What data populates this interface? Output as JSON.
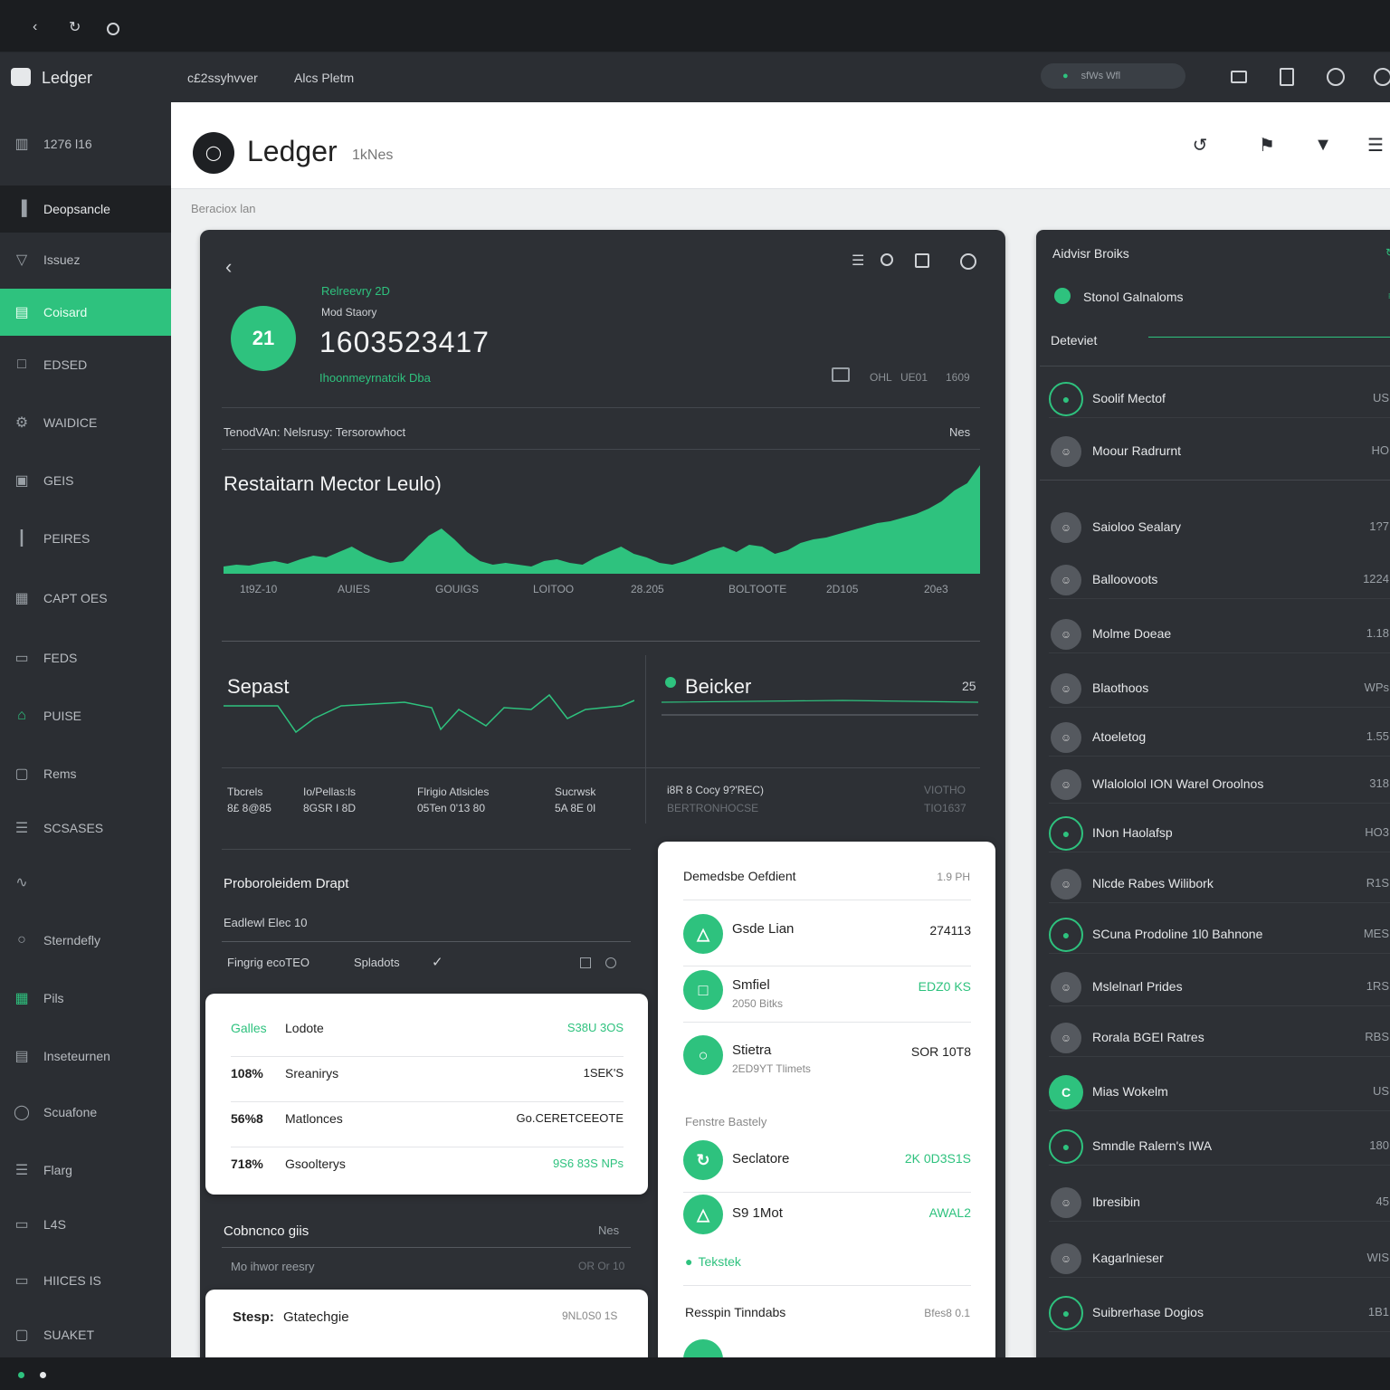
{
  "topbar": {
    "icons": [
      "back-icon",
      "refresh-icon",
      "circle-icon"
    ]
  },
  "appbar": {
    "logo": "Ledger",
    "menu": [
      "c£2ssyhvver",
      "Alcs Pletm"
    ],
    "search_placeholder": "sfWs Wfl"
  },
  "sidebar": {
    "items": [
      {
        "label": "1276 l16",
        "icon": "chart-icon"
      },
      {
        "label": "Deopsancle",
        "icon": "bar-icon"
      },
      {
        "label": "Issuez",
        "icon": "filter-icon"
      },
      {
        "label": "Coisard",
        "icon": "doc-icon"
      },
      {
        "label": "EDSED",
        "icon": "lock-icon"
      },
      {
        "label": "WAIDICE",
        "icon": "gear-icon"
      },
      {
        "label": "GEIS",
        "icon": "image-icon"
      },
      {
        "label": "PEIRES",
        "icon": "stats-icon"
      },
      {
        "label": "CAPT OES",
        "icon": "calendar-icon"
      },
      {
        "label": "FEDS",
        "icon": "file-icon"
      },
      {
        "label": "PUISE",
        "icon": "home-icon"
      },
      {
        "label": "Rems",
        "icon": "square-icon"
      },
      {
        "label": "SCSASES",
        "icon": "list-icon"
      },
      {
        "label": "",
        "icon": "route-icon"
      },
      {
        "label": "Sterndefly",
        "icon": "clock-icon"
      },
      {
        "label": "Pils",
        "icon": "calendar-icon"
      },
      {
        "label": "Inseteurnen",
        "icon": "window-icon"
      },
      {
        "label": "Scuafone",
        "icon": "circle-icon"
      },
      {
        "label": "Flarg",
        "icon": "list-icon"
      },
      {
        "label": "L4S",
        "icon": "folder-icon"
      },
      {
        "label": "HIICES IS",
        "icon": "inbox-icon"
      },
      {
        "label": "SUAKET",
        "icon": "square-icon"
      }
    ]
  },
  "header": {
    "title": "Ledger",
    "subtitle": "1kNes",
    "breadcrumb": "Beraciox lan"
  },
  "overview": {
    "badge": "21",
    "label1": "Relreevry 2D",
    "label2": "Mod Staory",
    "value": "1603523417",
    "sub": "Ihoonmeyrnatcik Dba",
    "right_meta": [
      "OHL",
      "UE01",
      "1609"
    ],
    "table_title": "TenodVAn: Nelsrusy: Tersorowhoct",
    "table_right": "Nes",
    "chart_title": "Restaitarn Mector Leulo)",
    "xticks": [
      "1t9Z-10",
      "AUIES",
      "GOUIGS",
      "LOITOO",
      "28.205",
      "BOLTOOTE",
      "2D105",
      "20e3"
    ]
  },
  "chart_data": {
    "type": "area",
    "x": [
      1,
      2,
      3,
      4,
      5,
      6,
      7,
      8,
      9,
      10,
      11,
      12,
      13,
      14,
      15,
      16,
      17,
      18,
      19,
      20,
      21,
      22,
      23,
      24,
      25,
      26,
      27,
      28,
      29,
      30,
      31,
      32,
      33,
      34,
      35,
      36,
      37,
      38,
      39,
      40,
      41,
      42,
      43,
      44,
      45,
      46,
      47,
      48,
      49,
      50,
      51,
      52,
      53,
      54,
      55,
      56,
      57,
      58,
      59,
      60
    ],
    "values": [
      8,
      10,
      9,
      12,
      14,
      11,
      16,
      20,
      18,
      24,
      30,
      22,
      16,
      12,
      14,
      28,
      42,
      50,
      38,
      24,
      14,
      10,
      12,
      10,
      8,
      14,
      16,
      12,
      10,
      18,
      24,
      30,
      22,
      18,
      12,
      10,
      14,
      20,
      26,
      30,
      24,
      32,
      30,
      22,
      26,
      34,
      38,
      40,
      44,
      48,
      52,
      56,
      58,
      62,
      66,
      72,
      80,
      92,
      100,
      120
    ],
    "series_color": "#2ec27e",
    "grid": false
  },
  "panels": {
    "left": {
      "title": "Sepast",
      "stats": [
        [
          "Tbcrels",
          "8£ 8@85"
        ],
        [
          "Io/Pellas:ls",
          "8GSR I 8D"
        ],
        [
          "Flrigio Atlsicles",
          "05Ten 0'13 80"
        ],
        [
          "Sucrwsk",
          "5A 8E 0I"
        ]
      ]
    },
    "right": {
      "title": "Beicker",
      "num": "25",
      "stats": [
        "i8R 8 Cocy 9?'REC)",
        "BERTRONHOCSE",
        "VIOTHO",
        "TIO1637"
      ]
    }
  },
  "product": {
    "title": "Proboroleidem Drapt",
    "sub": "Eadlewl Elec 10",
    "filter1": "Fingrig ecoTEO",
    "filter2": "Spladots",
    "rows": [
      {
        "a": "Galles",
        "b": "Lodote",
        "c": "S38U 3OS"
      },
      {
        "a": "108%",
        "b": "Sreanirys",
        "c": "1SEK'S"
      },
      {
        "a": "56%8",
        "b": "Matlonces",
        "c": "Go.CERETCEEOTE"
      },
      {
        "a": "718%",
        "b": "Gsoolterys",
        "c": "9S6 83S NPs"
      }
    ],
    "bottom_title": "Cobncnco giis",
    "bottom_right": "Nes",
    "bottom_sub": "Mo ihwor reesry",
    "bottom_sub_right": "OR Or 10",
    "card2_a": "Stesp:",
    "card2_b": "Gtatechgie",
    "card2_c": "9NL0S0 1S"
  },
  "details": {
    "title": "Demedsbe Oefdient",
    "title_right": "1.9 PH",
    "rows": [
      {
        "name": "Gsde Lian",
        "sub": "",
        "val": "274113",
        "icon": "triangle-icon"
      },
      {
        "name": "Smfiel",
        "sub": "2050 Bitks",
        "val": "EDZ0 KS",
        "icon": "square-icon"
      },
      {
        "name": "Stietra",
        "sub": "2ED9YT Tlimets",
        "val": "SOR 10T8",
        "icon": "circle-icon"
      }
    ],
    "section": "Fenstre Bastely",
    "rows2": [
      {
        "name": "Seclatore",
        "val": "2K 0D3S1S",
        "icon": "sync-icon"
      },
      {
        "name": "S9 1Mot",
        "val": "AWAL2",
        "icon": "triangle-icon"
      }
    ],
    "link": "Tekstek",
    "bottom_title": "Resspin Tinndabs",
    "bottom_right": "Bfes8 0.1"
  },
  "right_panel": {
    "title": "Aidvisr Broiks",
    "sub": "Stonol Galnaloms",
    "section": "Deteviet",
    "items": [
      {
        "name": "Soolif Mectof",
        "val": "US"
      },
      {
        "name": "Moour Radrurnt",
        "val": "HO"
      },
      {
        "name": "Saioloo Sealary",
        "val": "1?7"
      },
      {
        "name": "Balloovoots",
        "val": "1224"
      },
      {
        "name": "Molme Doeae",
        "val": "1.18"
      },
      {
        "name": "Blaothoos",
        "val": "WPs"
      },
      {
        "name": "Atoeletog",
        "val": "1.55"
      },
      {
        "name": "Wlalololol ION Warel Oroolnos",
        "val": "318"
      },
      {
        "name": "INon Haolafsp",
        "val": "HO3"
      },
      {
        "name": "Nlcde Rabes Wilibork",
        "val": "R1S"
      },
      {
        "name": "SCuna Prodoline 1l0 Bahnone",
        "val": "MES"
      },
      {
        "name": "Mslelnarl Prides",
        "val": "1RS"
      },
      {
        "name": "Rorala BGEI Ratres",
        "val": "RBS"
      },
      {
        "name": "Mias Wokelm",
        "val": "US"
      },
      {
        "name": "Smndle Ralern's IWA",
        "val": "180"
      },
      {
        "name": "Ibresibin",
        "val": "45"
      },
      {
        "name": "Kagarlnieser",
        "val": "WIS"
      },
      {
        "name": "Suibrerhase Dogios",
        "val": "1B1"
      }
    ]
  }
}
